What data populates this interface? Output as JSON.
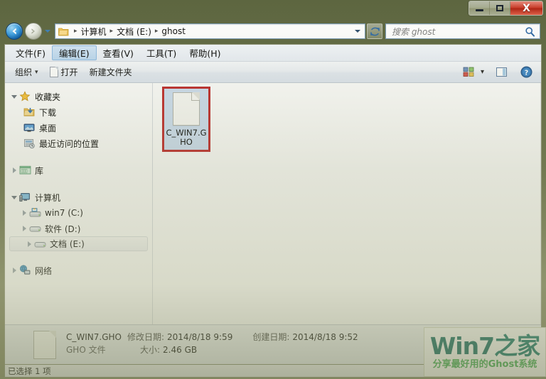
{
  "window": {
    "caption_buttons": {
      "minimize": "minimize-button",
      "maximize": "maximize-button",
      "close_glyph": "X"
    }
  },
  "address_bar": {
    "back_icon": "back-arrow-icon",
    "forward_icon": "forward-arrow-icon",
    "history_dropdown_icon": "chevron-down-icon",
    "folder_icon": "folder-icon",
    "crumbs": [
      "计算机",
      "文档 (E:)",
      "ghost"
    ],
    "separator": "▸",
    "dropdown_icon": "chevron-down-icon",
    "refresh_icon": "refresh-icon"
  },
  "search": {
    "placeholder": "搜索 ghost",
    "icon": "search-icon"
  },
  "menubar": {
    "items": [
      {
        "text": "文件(F)",
        "label": "文件",
        "accel": "F",
        "highlighted": false
      },
      {
        "text": "编辑(E)",
        "label": "编辑",
        "accel": "E",
        "highlighted": true
      },
      {
        "text": "查看(V)",
        "label": "查看",
        "accel": "V",
        "highlighted": false
      },
      {
        "text": "工具(T)",
        "label": "工具",
        "accel": "T",
        "highlighted": false
      },
      {
        "text": "帮助(H)",
        "label": "帮助",
        "accel": "H",
        "highlighted": false
      }
    ]
  },
  "toolbar": {
    "organize_label": "组织",
    "organize_caret": "▾",
    "open_label": "打开",
    "newfolder_label": "新建文件夹",
    "views_icon": "views-icon",
    "views_caret": "▾",
    "preview_icon": "preview-pane-icon",
    "help_icon": "help-icon"
  },
  "navpane": {
    "groups": [
      {
        "name": "favorites",
        "expander": "open",
        "icon": "star-icon",
        "label": "收藏夹",
        "children": [
          {
            "icon": "downloads-icon",
            "label": "下载"
          },
          {
            "icon": "desktop-icon",
            "label": "桌面"
          },
          {
            "icon": "recent-places-icon",
            "label": "最近访问的位置"
          }
        ]
      },
      {
        "name": "libraries",
        "expander": "closed",
        "icon": "library-icon",
        "label": "库",
        "children": []
      },
      {
        "name": "computer",
        "expander": "open",
        "icon": "computer-icon",
        "label": "计算机",
        "children": [
          {
            "icon": "system-drive-icon",
            "label": "win7 (C:)",
            "expander": "closed",
            "selected": false
          },
          {
            "icon": "drive-icon",
            "label": "软件 (D:)",
            "expander": "closed",
            "selected": false
          },
          {
            "icon": "drive-icon",
            "label": "文档 (E:)",
            "expander": "closed",
            "selected": true
          }
        ]
      },
      {
        "name": "network",
        "expander": "closed",
        "icon": "network-icon",
        "label": "网络",
        "children": []
      }
    ]
  },
  "filelist": {
    "items": [
      {
        "icon": "generic-file-icon",
        "name": "C_WIN7.GHO",
        "selected": true,
        "highlight_color": "#c0282a"
      }
    ]
  },
  "details": {
    "icon": "generic-file-icon",
    "file_name": "C_WIN7.GHO",
    "modified_key": "修改日期:",
    "modified_value": "2014/8/18 9:59",
    "created_key": "创建日期:",
    "created_value": "2014/8/18 9:52",
    "file_type": "GHO 文件",
    "size_key": "大小:",
    "size_value": "2.46 GB"
  },
  "statusbar": {
    "text": "已选择 1 项"
  },
  "watermark": {
    "main_latin": "Win7",
    "main_cn": "之家",
    "sub": "分享最好用的Ghost系统",
    "main_color": "#0f6b62",
    "sub_color": "#3fae52"
  }
}
